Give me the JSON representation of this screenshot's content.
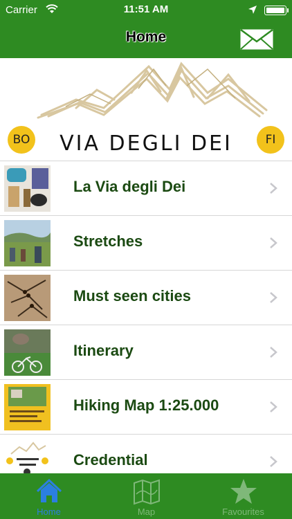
{
  "status_bar": {
    "carrier": "Carrier",
    "time": "11:51 AM"
  },
  "nav": {
    "title": "Home",
    "mail_icon": "envelope-icon"
  },
  "banner": {
    "left_badge": "BO",
    "right_badge": "FI",
    "logo_text": "VIA DEGLI DEI"
  },
  "list": {
    "items": [
      {
        "label": "La Via degli Dei",
        "thumb": "hiking-gear-photo"
      },
      {
        "label": "Stretches",
        "thumb": "hills-walkers-photo"
      },
      {
        "label": "Must seen cities",
        "thumb": "old-map-photo"
      },
      {
        "label": "Itinerary",
        "thumb": "bicycle-photo"
      },
      {
        "label": "Hiking Map 1:25.000",
        "thumb": "map-cover-photo"
      },
      {
        "label": "Credential",
        "thumb": "logo-thumbnail"
      }
    ]
  },
  "tabbar": {
    "tabs": [
      {
        "label": "Home",
        "icon": "house-icon",
        "selected": true
      },
      {
        "label": "Map",
        "icon": "map-icon",
        "selected": false
      },
      {
        "label": "Favourites",
        "icon": "star-icon",
        "selected": false
      }
    ]
  },
  "colors": {
    "brand_green": "#2e8b22",
    "label_green": "#1b4a12",
    "tab_active": "#2b7fe0",
    "badge_yellow": "#f2c21b"
  }
}
